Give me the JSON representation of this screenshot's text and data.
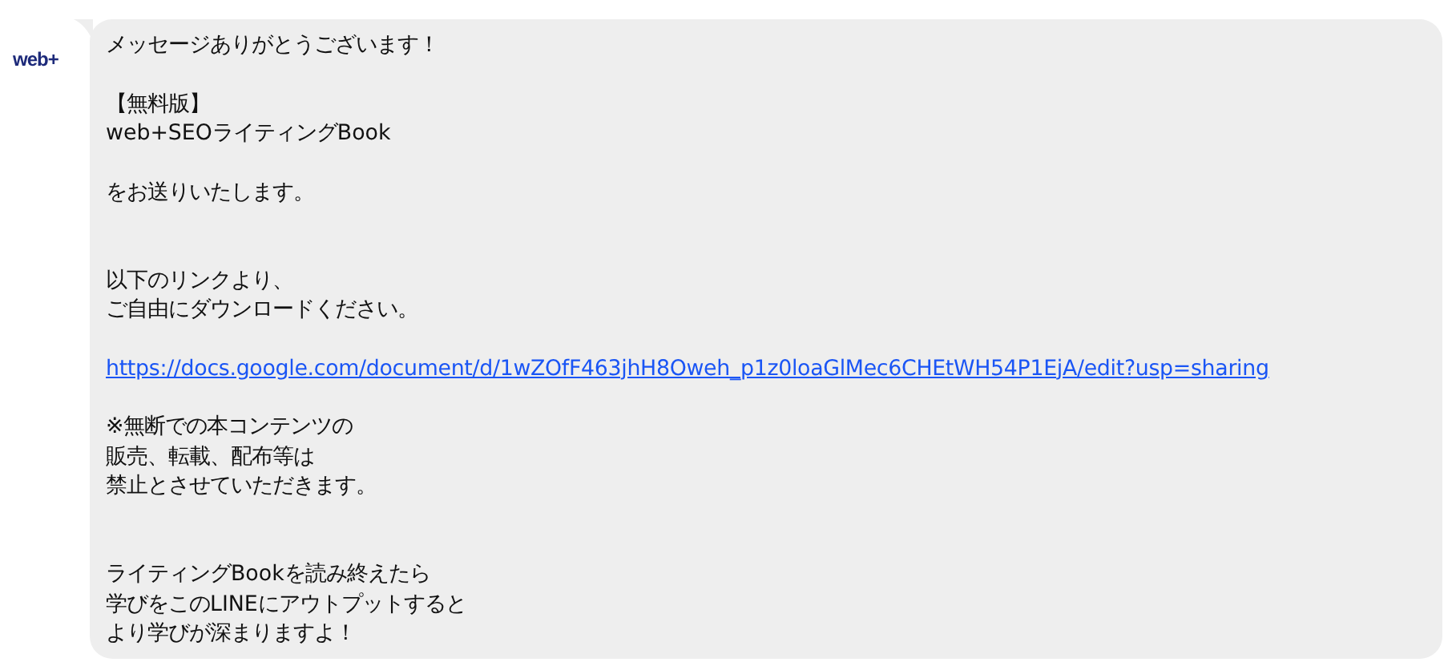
{
  "sender": {
    "logo": "web+"
  },
  "message": {
    "lines": [
      {
        "kind": "text",
        "text": "メッセージありがとうございます！"
      },
      {
        "kind": "blank"
      },
      {
        "kind": "text",
        "text": "【無料版】"
      },
      {
        "kind": "text",
        "text": "web+SEOライティングBook"
      },
      {
        "kind": "blank"
      },
      {
        "kind": "text",
        "text": "をお送りいたします。"
      },
      {
        "kind": "blank"
      },
      {
        "kind": "blank"
      },
      {
        "kind": "text",
        "text": "以下のリンクより、"
      },
      {
        "kind": "text",
        "text": "ご自由にダウンロードください。"
      },
      {
        "kind": "blank"
      },
      {
        "kind": "link",
        "text": "https://docs.google.com/document/d/1wZOfF463jhH8Oweh_p1z0loaGlMec6CHEtWH54P1EjA/edit?usp=sharing"
      },
      {
        "kind": "blank"
      },
      {
        "kind": "text",
        "text": "※無断での本コンテンツの"
      },
      {
        "kind": "text",
        "text": "販売、転載、配布等は"
      },
      {
        "kind": "text",
        "text": "禁止とさせていただきます。"
      },
      {
        "kind": "blank"
      },
      {
        "kind": "blank"
      },
      {
        "kind": "text",
        "text": "ライティングBookを読み終えたら"
      },
      {
        "kind": "text",
        "text": "学びをこのLINEにアウトプットすると"
      },
      {
        "kind": "text",
        "text": "より学びが深まりますよ！"
      }
    ]
  }
}
